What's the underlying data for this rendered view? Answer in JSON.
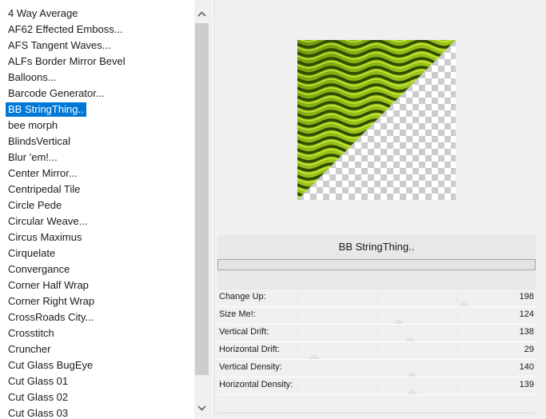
{
  "filter_list": {
    "items": [
      "4 Way Average",
      "AF62 Effected Emboss...",
      "AFS Tangent Waves...",
      "ALFs Border Mirror Bevel",
      "Balloons...",
      "Barcode Generator...",
      "BB StringThing..",
      "bee morph",
      "BlindsVertical",
      "Blur 'em!...",
      "Center Mirror...",
      "Centripedal Tile",
      "Circle Pede",
      "Circular Weave...",
      "Circus Maximus",
      "Cirquelate",
      "Convergance",
      "Corner Half Wrap",
      "Corner Right Wrap",
      "CrossRoads City...",
      "Crosstitch",
      "Cruncher",
      "Cut Glass  BugEye",
      "Cut Glass 01",
      "Cut Glass 02",
      "Cut Glass 03"
    ],
    "selected_index": 6
  },
  "scrollbar": {
    "up_icon": "chevron-up-icon",
    "down_icon": "chevron-down-icon"
  },
  "filter_panel": {
    "name": "BB StringThing.."
  },
  "parameters": [
    {
      "label": "Change Up:",
      "value": "198",
      "level": 0.78
    },
    {
      "label": "Size Me!:",
      "value": "124",
      "level": 0.49
    },
    {
      "label": "Vertical Drift:",
      "value": "138",
      "level": 0.54
    },
    {
      "label": "Horizontal Drift:",
      "value": "29",
      "level": 0.11
    },
    {
      "label": "Vertical Density:",
      "value": "140",
      "level": 0.55
    },
    {
      "label": "Horizontal Density:",
      "value": "139",
      "level": 0.55
    }
  ],
  "colors": {
    "selection": "#0078d7",
    "preview_wave_dark": "#2f4a00",
    "preview_wave_light": "#d6ef3a"
  }
}
